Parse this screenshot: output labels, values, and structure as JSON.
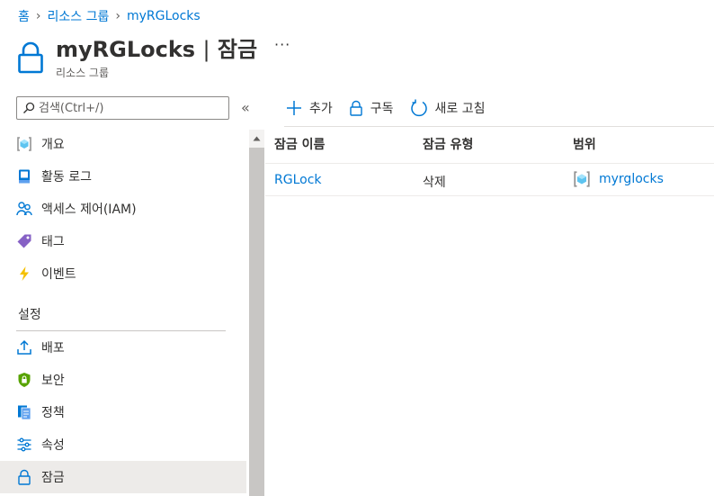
{
  "breadcrumb": {
    "items": [
      "홈",
      "리소스 그룹",
      "myRGLocks"
    ]
  },
  "header": {
    "resource_name": "myRGLocks",
    "separator": "|",
    "blade_title": "잠금",
    "subtitle": "리소스 그룹",
    "more_label": "···"
  },
  "search": {
    "placeholder": "검색(Ctrl+/)",
    "collapse_label": "«"
  },
  "sidebar": {
    "items": [
      {
        "label": "개요",
        "icon": "resource-group-icon"
      },
      {
        "label": "활동 로그",
        "icon": "activity-log-icon"
      },
      {
        "label": "액세스 제어(IAM)",
        "icon": "people-icon"
      },
      {
        "label": "태그",
        "icon": "tag-icon"
      },
      {
        "label": "이벤트",
        "icon": "lightning-icon"
      }
    ],
    "section_title": "설정",
    "settings_items": [
      {
        "label": "배포",
        "icon": "upload-icon"
      },
      {
        "label": "보안",
        "icon": "shield-icon"
      },
      {
        "label": "정책",
        "icon": "policy-icon"
      },
      {
        "label": "속성",
        "icon": "sliders-icon"
      },
      {
        "label": "잠금",
        "icon": "lock-icon",
        "active": true
      }
    ]
  },
  "toolbar": {
    "add_label": "추가",
    "subscription_label": "구독",
    "refresh_label": "새로 고침"
  },
  "table": {
    "columns": [
      "잠금 이름",
      "잠금 유형",
      "범위"
    ],
    "rows": [
      {
        "name": "RGLock",
        "type": "삭제",
        "scope": "myrglocks"
      }
    ]
  },
  "colors": {
    "link": "#0078d4",
    "active_nav_bg": "#edebe9",
    "text": "#323130",
    "secondary_text": "#605e5c"
  }
}
